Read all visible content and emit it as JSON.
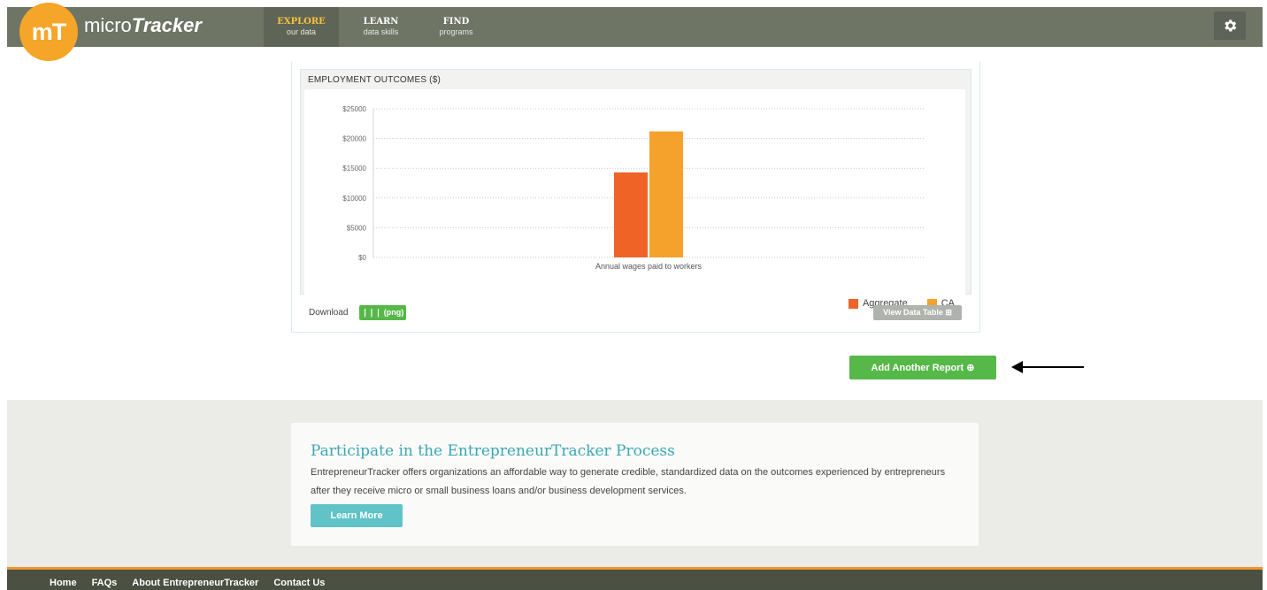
{
  "brand": {
    "logo_text": "mT",
    "name_light": "micro",
    "name_bold": "Tracker"
  },
  "nav": [
    {
      "title": "EXPLORE",
      "subtitle": "our data"
    },
    {
      "title": "LEARN",
      "subtitle": "data skills"
    },
    {
      "title": "FIND",
      "subtitle": "programs"
    }
  ],
  "settings_icon": "gear-icon",
  "chart_data": {
    "type": "bar",
    "title": "EMPLOYMENT OUTCOMES ($)",
    "categories": [
      "Annual wages paid to workers"
    ],
    "series": [
      {
        "name": "Aggregate",
        "values": [
          14300
        ],
        "color": "#f06326"
      },
      {
        "name": "CA",
        "values": [
          21200
        ],
        "color": "#f5a22c"
      }
    ],
    "ylim": [
      0,
      25000
    ],
    "yticks": [
      "$25000",
      "$20000",
      "$15000",
      "$10000",
      "$5000",
      "$0"
    ],
    "grid": true,
    "legend": "bottom-right"
  },
  "chart_controls": {
    "download_label": "Download",
    "png_button": "❘❘❘ (png)",
    "view_table_button": "View Data Table ⊞"
  },
  "add_report_button": "Add Another Report ⊕",
  "promo": {
    "title": "Participate in the EntrepreneurTracker Process",
    "body": "EntrepreneurTracker offers organizations an affordable way to generate credible, standardized data on the outcomes experienced by entrepreneurs after they receive micro or small business loans and/or business development services.",
    "button": "Learn More"
  },
  "footer": {
    "links": [
      "Home",
      "FAQs",
      "About EntrepreneurTracker",
      "Contact Us"
    ]
  }
}
